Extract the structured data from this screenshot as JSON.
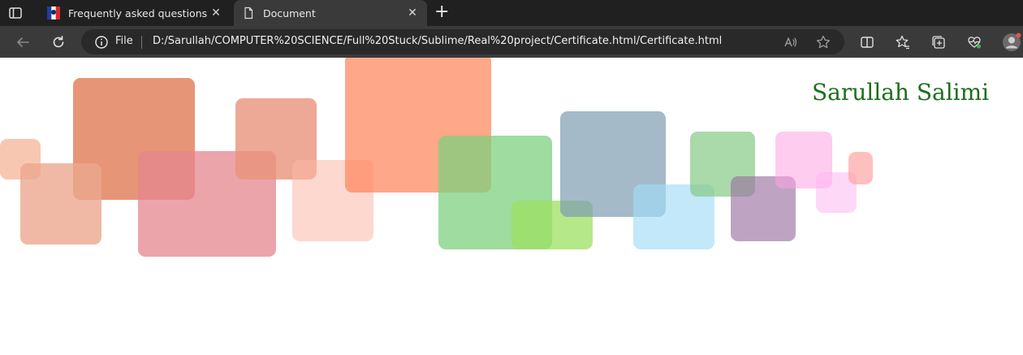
{
  "browser": {
    "tabs": [
      {
        "title": "Frequently asked questions - Fra",
        "active": false,
        "icon": "flag-icon"
      },
      {
        "title": "Document",
        "active": true,
        "icon": "page-icon"
      }
    ],
    "address": {
      "scheme_label": "File",
      "url": "D:/Sarullah/COMPUTER%20SCIENCE/Full%20Stuck/Sublime/Real%20project/Certificate.html/Certificate.html"
    },
    "icons": {
      "back": "back-arrow-icon",
      "refresh": "refresh-icon",
      "read_aloud": "read-aloud-icon",
      "favorite": "star-icon",
      "split": "split-screen-icon",
      "favorites": "favorites-icon",
      "collections": "collections-icon",
      "health": "browser-essentials-icon",
      "profile": "profile-avatar-icon"
    }
  },
  "page": {
    "name": "Sarullah Salimi",
    "name_color": "#1d6e1d",
    "squares": [
      {
        "color": "#e07a55",
        "opacity": 0.8
      },
      {
        "color": "#f4a27e",
        "opacity": 0.6
      },
      {
        "color": "#eba78f",
        "opacity": 0.8
      },
      {
        "color": "#e5868f",
        "opacity": 0.75
      },
      {
        "color": "#e8937a",
        "opacity": 0.8
      },
      {
        "color": "#fbb8a6",
        "opacity": 0.55
      },
      {
        "color": "#fd8a62",
        "opacity": 0.75
      },
      {
        "color": "#7fd07f",
        "opacity": 0.75
      },
      {
        "color": "#9ce060",
        "opacity": 0.75
      },
      {
        "color": "#7e9db0",
        "opacity": 0.7
      },
      {
        "color": "#a2dcf7",
        "opacity": 0.65
      },
      {
        "color": "#86c986",
        "opacity": 0.7
      },
      {
        "color": "#9b73a2",
        "opacity": 0.65
      },
      {
        "color": "#fda2e2",
        "opacity": 0.55
      },
      {
        "color": "#fbb3ef",
        "opacity": 0.5
      },
      {
        "color": "#fd9c9c",
        "opacity": 0.65
      }
    ]
  }
}
